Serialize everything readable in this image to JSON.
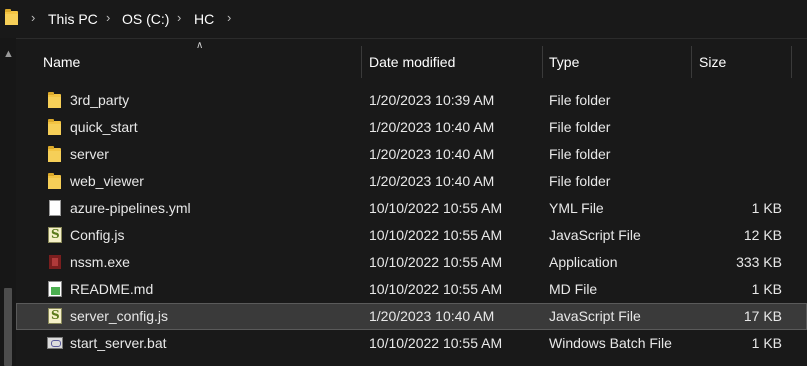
{
  "breadcrumb": {
    "items": [
      "This PC",
      "OS (C:)",
      "HC"
    ],
    "separator": ">"
  },
  "columns": {
    "name": "Name",
    "date": "Date modified",
    "type": "Type",
    "size": "Size"
  },
  "rows": [
    {
      "name": "3rd_party",
      "date": "1/20/2023 10:39 AM",
      "type": "File folder",
      "size": "",
      "icon": "folder-icon"
    },
    {
      "name": "quick_start",
      "date": "1/20/2023 10:40 AM",
      "type": "File folder",
      "size": "",
      "icon": "folder-icon"
    },
    {
      "name": "server",
      "date": "1/20/2023 10:40 AM",
      "type": "File folder",
      "size": "",
      "icon": "folder-icon"
    },
    {
      "name": "web_viewer",
      "date": "1/20/2023 10:40 AM",
      "type": "File folder",
      "size": "",
      "icon": "folder-icon"
    },
    {
      "name": "azure-pipelines.yml",
      "date": "10/10/2022 10:55 AM",
      "type": "YML File",
      "size": "1 KB",
      "icon": "document-icon"
    },
    {
      "name": "Config.js",
      "date": "10/10/2022 10:55 AM",
      "type": "JavaScript File",
      "size": "12 KB",
      "icon": "javascript-file-icon"
    },
    {
      "name": "nssm.exe",
      "date": "10/10/2022 10:55 AM",
      "type": "Application",
      "size": "333 KB",
      "icon": "application-icon"
    },
    {
      "name": "README.md",
      "date": "10/10/2022 10:55 AM",
      "type": "MD File",
      "size": "1 KB",
      "icon": "markdown-file-icon"
    },
    {
      "name": "server_config.js",
      "date": "1/20/2023 10:40 AM",
      "type": "JavaScript File",
      "size": "17 KB",
      "icon": "javascript-file-icon",
      "selected": true
    },
    {
      "name": "start_server.bat",
      "date": "10/10/2022 10:55 AM",
      "type": "Windows Batch File",
      "size": "1 KB",
      "icon": "batch-file-icon"
    }
  ],
  "colors": {
    "background": "#191919",
    "selected_row": "#3a3a3a",
    "folder": "#f3c443"
  }
}
